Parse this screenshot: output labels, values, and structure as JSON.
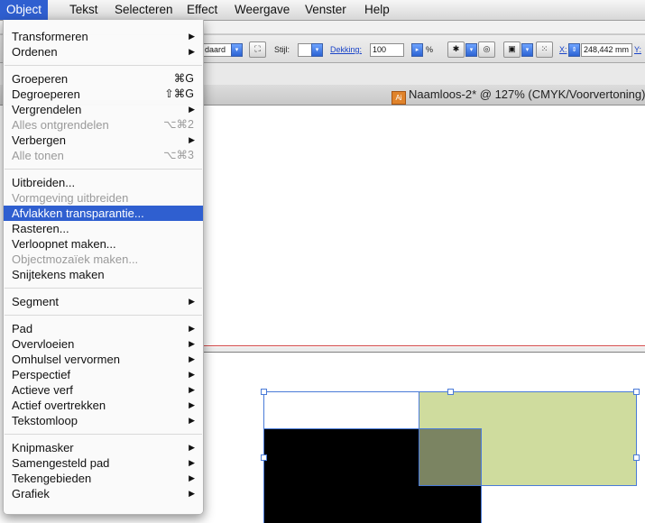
{
  "menubar": {
    "items": [
      {
        "label": "Object",
        "active": true
      },
      {
        "label": "Tekst"
      },
      {
        "label": "Selecteren"
      },
      {
        "label": "Effect"
      },
      {
        "label": "Weergave"
      },
      {
        "label": "Venster"
      },
      {
        "label": "Help"
      }
    ]
  },
  "toolbar": {
    "style_dropdown": "daard",
    "style_label": "Stijl:",
    "opacity_label": "Dekking:",
    "opacity_value": "100",
    "percent": "%",
    "x_label": "X:",
    "x_value": "248,442 mm",
    "y_label": "Y:"
  },
  "document": {
    "title": "Naamloos-2* @ 127% (CMYK/Voorvertoning)"
  },
  "object_menu": {
    "groups": [
      [
        {
          "label": "Transformeren",
          "submenu": true
        },
        {
          "label": "Ordenen",
          "submenu": true
        }
      ],
      [
        {
          "label": "Groeperen",
          "shortcut": "⌘G"
        },
        {
          "label": "Degroeperen",
          "shortcut": "⇧⌘G"
        },
        {
          "label": "Vergrendelen",
          "submenu": true
        },
        {
          "label": "Alles ontgrendelen",
          "shortcut": "⌥⌘2",
          "disabled": true
        },
        {
          "label": "Verbergen",
          "submenu": true
        },
        {
          "label": "Alle tonen",
          "shortcut": "⌥⌘3",
          "disabled": true
        }
      ],
      [
        {
          "label": "Uitbreiden..."
        },
        {
          "label": "Vormgeving uitbreiden",
          "disabled": true
        },
        {
          "label": "Afvlakken transparantie...",
          "highlighted": true
        },
        {
          "label": "Rasteren..."
        },
        {
          "label": "Verloopnet maken..."
        },
        {
          "label": "Objectmozaïek maken...",
          "disabled": true
        },
        {
          "label": "Snijtekens maken"
        }
      ],
      [
        {
          "label": "Segment",
          "submenu": true
        }
      ],
      [
        {
          "label": "Pad",
          "submenu": true
        },
        {
          "label": "Overvloeien",
          "submenu": true
        },
        {
          "label": "Omhulsel vervormen",
          "submenu": true
        },
        {
          "label": "Perspectief",
          "submenu": true
        },
        {
          "label": "Actieve verf",
          "submenu": true
        },
        {
          "label": "Actief overtrekken",
          "submenu": true
        },
        {
          "label": "Tekstomloop",
          "submenu": true
        }
      ],
      [
        {
          "label": "Knipmasker",
          "submenu": true
        },
        {
          "label": "Samengesteld pad",
          "submenu": true
        },
        {
          "label": "Tekengebieden",
          "submenu": true
        },
        {
          "label": "Grafiek",
          "submenu": true
        }
      ]
    ]
  },
  "colors": {
    "menu_highlight": "#2f5fd0",
    "green_rect": "#cfdc9e",
    "black_rect": "#000000",
    "overlap_rect": "#7b8462",
    "selection": "#4a7bd8"
  }
}
